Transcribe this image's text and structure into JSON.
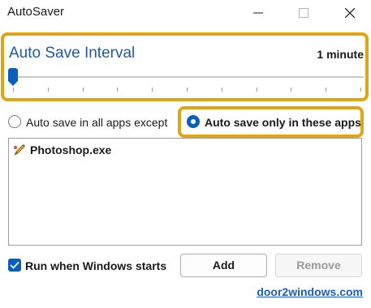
{
  "window": {
    "title": "AutoSaver",
    "controls": {
      "minimize_icon": "minimize-icon",
      "maximize_icon": "maximize-icon",
      "close_icon": "close-icon"
    }
  },
  "interval": {
    "title": "Auto Save Interval",
    "value_label": "1 minute",
    "slider_level": 0
  },
  "mode": {
    "except_label": "Auto save in all apps except",
    "only_label": "Auto save only in these apps",
    "selected": "only"
  },
  "apps": [
    {
      "name": "Photoshop.exe",
      "icon": "photoshop-app-icon"
    }
  ],
  "startup": {
    "label": "Run when Windows starts",
    "checked": true
  },
  "buttons": {
    "add": "Add",
    "remove": "Remove"
  },
  "link": {
    "text": "door2windows.com"
  },
  "colors": {
    "accent": "#0a5fbd",
    "highlight": "#e2a411",
    "interval_title": "#1e5aa8",
    "link": "#1f5dbf"
  }
}
